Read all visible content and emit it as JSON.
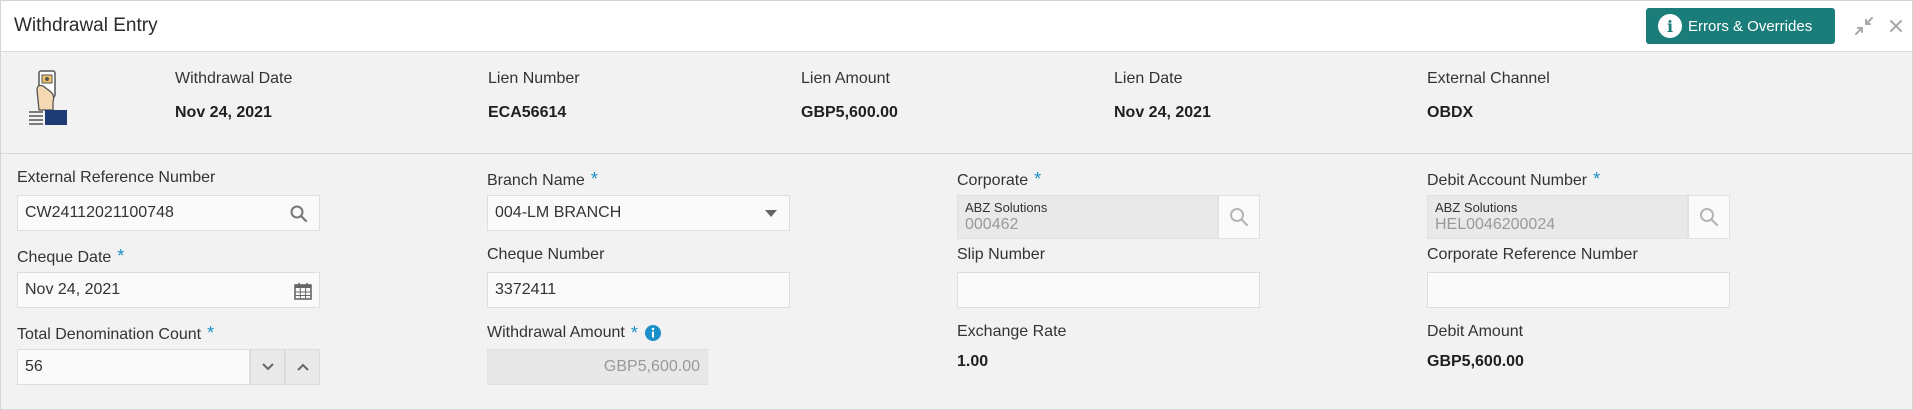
{
  "header": {
    "title": "Withdrawal Entry",
    "errors_button_label": "Errors & Overrides",
    "accent_color": "#1a7d79"
  },
  "summary": {
    "icon": "withdrawal-document-icon",
    "items": [
      {
        "label": "Withdrawal Date",
        "value": "Nov 24, 2021"
      },
      {
        "label": "Lien Number",
        "value": "ECA56614"
      },
      {
        "label": "Lien Amount",
        "value": "GBP5,600.00"
      },
      {
        "label": "Lien Date",
        "value": "Nov 24, 2021"
      },
      {
        "label": "External Channel",
        "value": "OBDX"
      }
    ]
  },
  "form": {
    "required_marker": "*",
    "external_reference": {
      "label": "External Reference Number",
      "value": "CW24112021100748"
    },
    "branch_name": {
      "label": "Branch Name",
      "value": "004-LM BRANCH"
    },
    "corporate": {
      "label": "Corporate",
      "name": "ABZ Solutions",
      "code": "000462"
    },
    "debit_account": {
      "label": "Debit Account Number",
      "name": "ABZ Solutions",
      "code": "HEL0046200024"
    },
    "cheque_date": {
      "label": "Cheque Date",
      "value": "Nov 24, 2021"
    },
    "cheque_number": {
      "label": "Cheque Number",
      "value": "3372411"
    },
    "slip_number": {
      "label": "Slip Number",
      "value": ""
    },
    "corporate_reference": {
      "label": "Corporate Reference Number",
      "value": ""
    },
    "total_denomination": {
      "label": "Total Denomination Count",
      "value": "56"
    },
    "withdrawal_amount": {
      "label": "Withdrawal Amount",
      "value": "GBP5,600.00"
    },
    "exchange_rate": {
      "label": "Exchange Rate",
      "value": "1.00"
    },
    "debit_amount": {
      "label": "Debit Amount",
      "value": "GBP5,600.00"
    }
  }
}
